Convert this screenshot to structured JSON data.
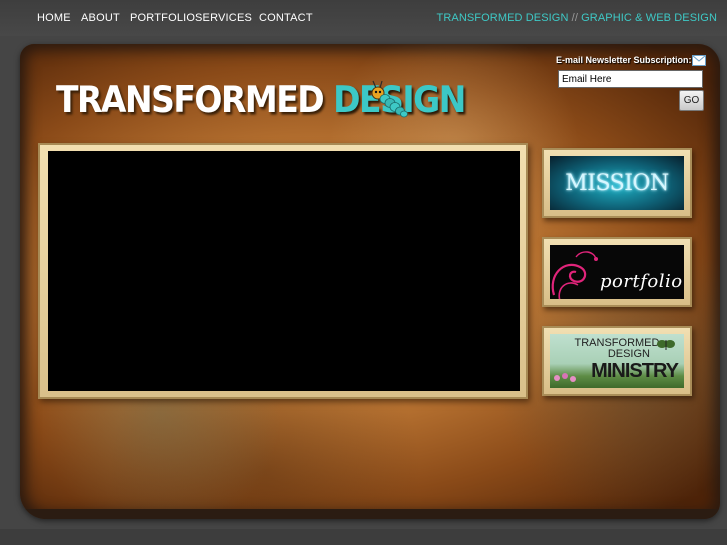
{
  "nav": {
    "items": [
      {
        "label": "HOME"
      },
      {
        "label": "ABOUT"
      },
      {
        "label": "PORTFOLIO"
      },
      {
        "label": "SERVICES"
      },
      {
        "label": "CONTACT"
      }
    ],
    "tagline_brand": "TRANSFORMED DESIGN",
    "tagline_separator": "//",
    "tagline_service": "GRAPHIC & WEB DESIGN"
  },
  "logo": {
    "word1": "TRANSFORMED",
    "word2": "DESIGN"
  },
  "newsletter": {
    "label": "E-mail Newsletter Subscription:",
    "placeholder": "Email Here",
    "go_label": "GO"
  },
  "tiles": {
    "mission": "MISSION",
    "portfolio": "portfolio",
    "ministry_line1": "TRANSFORMED",
    "ministry_line2": "DESIGN",
    "ministry_line3": "MINISTRY"
  },
  "colors": {
    "accent_teal": "#3cc8c6",
    "nav_background": "#454545",
    "board_orange": "#c07a36"
  },
  "icons": {
    "newsletter": "envelope-icon",
    "logo_mascot": "caterpillar-icon"
  }
}
